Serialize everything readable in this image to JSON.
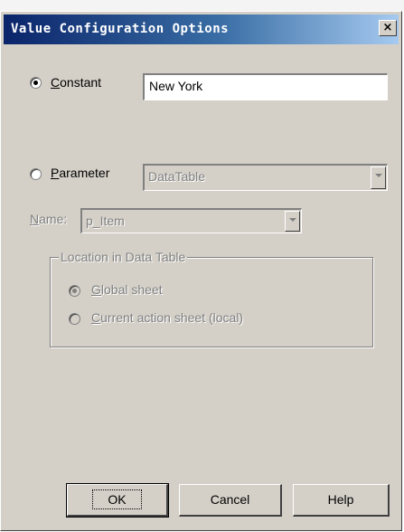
{
  "dialog": {
    "title": "Value Configuration Options",
    "close_glyph": "×"
  },
  "constant": {
    "label_mnemonic": "C",
    "label_rest": "onstant",
    "checked": true,
    "value": "New York"
  },
  "parameter": {
    "label_mnemonic": "P",
    "label_rest": "arameter",
    "checked": false,
    "type_value": "DataTable",
    "name_label_mnemonic": "N",
    "name_label_rest": "ame:",
    "name_value": "p_Item"
  },
  "location": {
    "legend": "Location in Data Table",
    "global_mnemonic": "G",
    "global_rest": "lobal sheet",
    "global_checked": true,
    "current_mnemonic": "C",
    "current_rest": "urrent action sheet (local)",
    "current_checked": false
  },
  "buttons": {
    "ok_label": "OK",
    "cancel_label": "Cancel",
    "help_label": "Help"
  },
  "icons": {
    "close": "close-icon",
    "dropdown": "chevron-down-icon",
    "radio": "radio-icon"
  },
  "colors": {
    "titlebar_start": "#0a246a",
    "titlebar_end": "#a6caf0",
    "dialog_bg": "#d4d0c8",
    "disabled_text": "#808080"
  }
}
